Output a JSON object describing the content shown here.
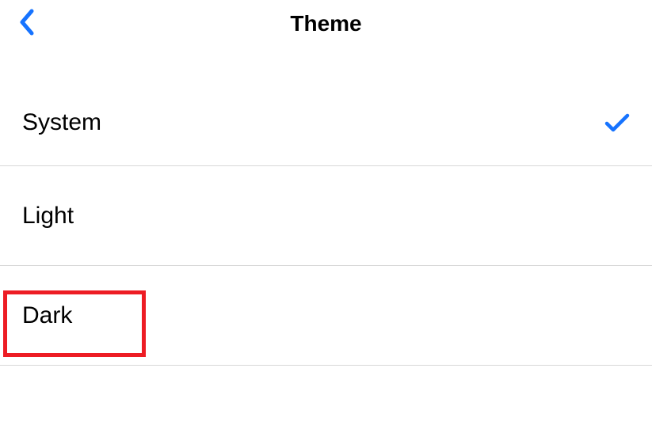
{
  "header": {
    "title": "Theme"
  },
  "options": [
    {
      "label": "System",
      "selected": true
    },
    {
      "label": "Light",
      "selected": false
    },
    {
      "label": "Dark",
      "selected": false
    }
  ],
  "colors": {
    "accent": "#1673ff",
    "highlight": "#ed1c24"
  }
}
